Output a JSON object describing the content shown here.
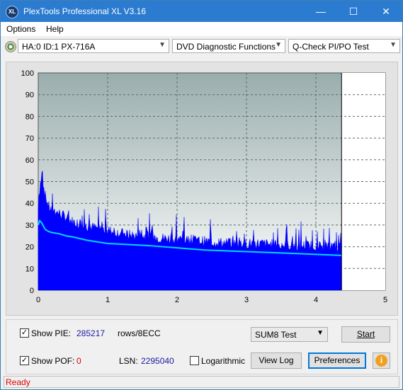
{
  "window": {
    "title": "PlexTools Professional XL V3.16",
    "app_icon_text": "XL"
  },
  "menu": {
    "items": [
      "Options",
      "Help"
    ]
  },
  "toolbar": {
    "drive": "HA:0 ID:1  PX-716A",
    "function": "DVD Diagnostic Functions",
    "test": "Q-Check PI/PO Test"
  },
  "chart_data": {
    "type": "area",
    "y_ticks": [
      "100",
      "90",
      "80",
      "70",
      "60",
      "50",
      "40",
      "30",
      "20",
      "10",
      "0"
    ],
    "x_ticks": [
      "0",
      "1",
      "2",
      "3",
      "4",
      "5"
    ],
    "xlim": [
      0,
      5
    ],
    "ylim": [
      0,
      100
    ],
    "grid": true,
    "end_marker_x": 4.37,
    "series": [
      {
        "color": "#0000ff",
        "x": [
          0,
          0.02,
          0.05,
          0.1,
          0.15,
          0.2,
          0.3,
          0.4,
          0.5,
          0.7,
          1.0,
          1.3,
          1.6,
          2.0,
          2.4,
          2.8,
          3.2,
          3.6,
          4.0,
          4.37
        ],
        "y": [
          38,
          48,
          55,
          45,
          40,
          38,
          37,
          35,
          33,
          31,
          29,
          27,
          26,
          25,
          24,
          23,
          23,
          22,
          22,
          21
        ]
      },
      {
        "color": "#00d8ff",
        "x": [
          0,
          0.02,
          0.05,
          0.1,
          0.15,
          0.2,
          0.3,
          0.4,
          0.5,
          0.7,
          1.0,
          1.3,
          1.6,
          2.0,
          2.4,
          2.8,
          3.2,
          3.6,
          4.0,
          4.37
        ],
        "y": [
          30,
          32,
          31,
          28,
          27,
          26.5,
          26,
          25,
          24.5,
          23,
          21.5,
          21,
          20.5,
          19.5,
          18.5,
          18,
          17.5,
          17,
          16.5,
          16
        ]
      }
    ]
  },
  "controls": {
    "show_pie_label": "Show PIE:",
    "pie_value": "285217",
    "rows_label": "rows/8ECC",
    "show_pof_label": "Show POF:",
    "pof_value": "0",
    "lsn_label": "LSN:",
    "lsn_value": "2295040",
    "logarithmic_label": "Logarithmic",
    "test_select": "SUM8 Test",
    "start": "Start",
    "view_log": "View Log",
    "preferences": "Preferences"
  },
  "status": {
    "text": "Ready"
  }
}
